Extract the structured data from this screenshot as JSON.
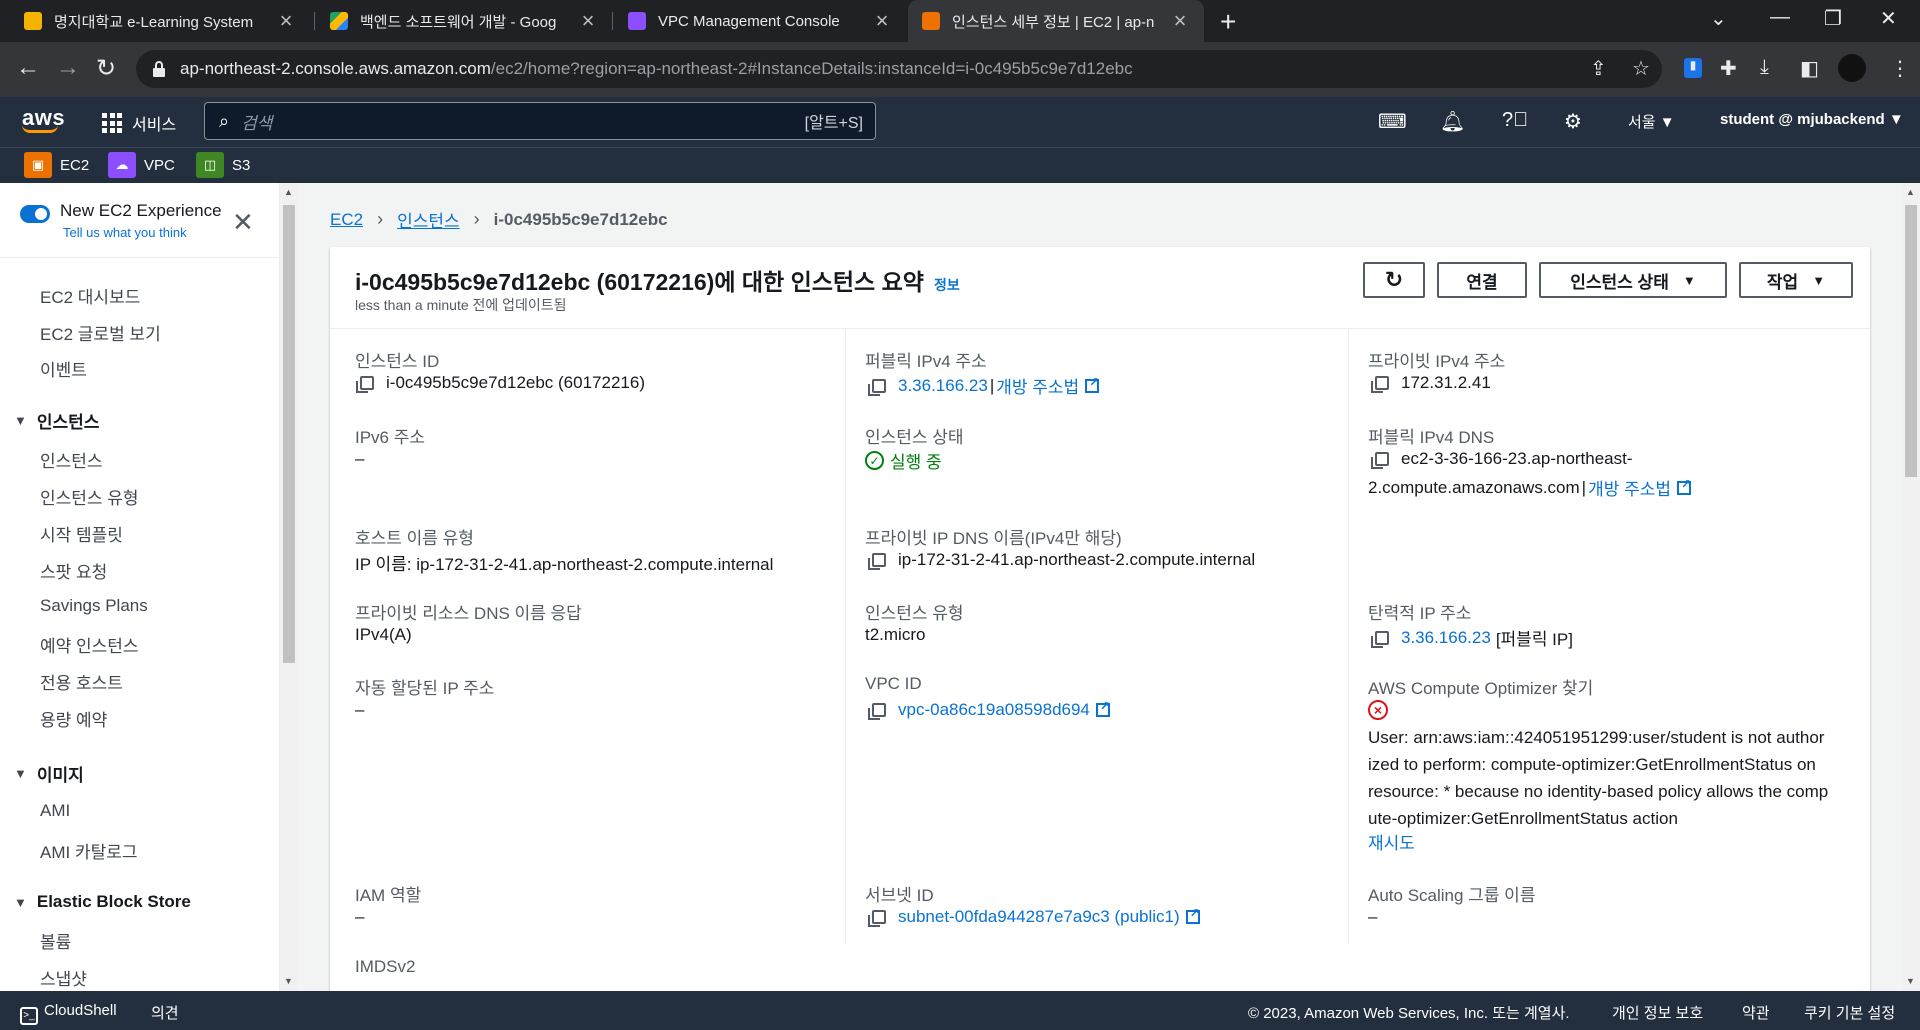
{
  "browser": {
    "tabs": [
      {
        "title": "명지대학교 e-Learning System",
        "active": false,
        "favicon_color": "#f5b300"
      },
      {
        "title": "백엔드 소프트웨어 개발 - Goog",
        "active": false,
        "favicon_color": "#1ea362"
      },
      {
        "title": "VPC Management Console",
        "active": false,
        "favicon_color": "#8c4fff"
      },
      {
        "title": "인스턴스 세부 정보 | EC2 | ap-n",
        "active": true,
        "favicon_color": "#ed7100"
      }
    ],
    "url_host": "ap-northeast-2.console.aws.amazon.com",
    "url_path": "/ec2/home?region=ap-northeast-2#InstanceDetails:instanceId=i-0c495b5c9e7d12ebc"
  },
  "aws_header": {
    "logo": "aws",
    "services_label": "서비스",
    "search_placeholder": "검색",
    "search_shortcut": "[알트+S]",
    "region": "서울 ▼",
    "user": "student @ mjubackend ▼"
  },
  "favorites": [
    {
      "label": "EC2",
      "color": "#ed7100"
    },
    {
      "label": "VPC",
      "color": "#8c4fff"
    },
    {
      "label": "S3",
      "color": "#3f8624"
    }
  ],
  "sidebar": {
    "new_exp_title": "New EC2 Experience",
    "new_exp_sub": "Tell us what you think",
    "items": {
      "dashboard": "EC2 대시보드",
      "global": "EC2 글로벌 보기",
      "events": "이벤트",
      "instances_head": "인스턴스",
      "instances": "인스턴스",
      "instance_types": "인스턴스 유형",
      "launch_templates": "시작 템플릿",
      "spot": "스팟 요청",
      "savings": "Savings Plans",
      "reserved": "예약 인스턴스",
      "dedicated": "전용 호스트",
      "capacity": "용량 예약",
      "images_head": "이미지",
      "ami": "AMI",
      "ami_catalog": "AMI 카탈로그",
      "ebs_head": "Elastic Block Store",
      "volumes": "볼륨",
      "snapshots": "스냅샷"
    }
  },
  "breadcrumb": {
    "root": "EC2",
    "mid": "인스턴스",
    "current": "i-0c495b5c9e7d12ebc"
  },
  "summary": {
    "title": "i-0c495b5c9e7d12ebc (60172216)에 대한 인스턴스 요약",
    "info": "정보",
    "updated": "less than a minute 전에 업데이트됨",
    "buttons": {
      "connect": "연결",
      "state": "인스턴스 상태",
      "actions": "작업"
    },
    "fields": {
      "instance_id_label": "인스턴스 ID",
      "instance_id": "i-0c495b5c9e7d12ebc (60172216)",
      "public_ipv4_label": "퍼블릭 IPv4 주소",
      "public_ipv4": "3.36.166.23",
      "open_address": "개방 주소법",
      "private_ipv4_label": "프라이빗 IPv4 주소",
      "private_ipv4": "172.31.2.41",
      "ipv6_label": "IPv6 주소",
      "ipv6": "–",
      "state_label": "인스턴스 상태",
      "state": "실행 중",
      "public_dns_label": "퍼블릭 IPv4 DNS",
      "public_dns_line1": "ec2-3-36-166-23.ap-northeast-",
      "public_dns_line2": "2.compute.amazonaws.com",
      "hostname_type_label": "호스트 이름 유형",
      "hostname_type": "IP 이름: ip-172-31-2-41.ap-northeast-2.compute.internal",
      "private_dns_label": "프라이빗 IP DNS 이름(IPv4만 해당)",
      "private_dns": "ip-172-31-2-41.ap-northeast-2.compute.internal",
      "resource_dns_label": "프라이빗 리소스 DNS 이름 응답",
      "resource_dns": "IPv4(A)",
      "instance_type_label": "인스턴스 유형",
      "instance_type": "t2.micro",
      "elastic_ip_label": "탄력적 IP 주소",
      "elastic_ip": "3.36.166.23",
      "elastic_ip_suffix": "[퍼블릭 IP]",
      "auto_ip_label": "자동 할당된 IP 주소",
      "auto_ip": "–",
      "vpc_label": "VPC ID",
      "vpc": "vpc-0a86c19a08598d694",
      "optimizer_label": "AWS Compute Optimizer 찾기",
      "optimizer_l1": "User: arn:aws:iam::424051951299:user/student is not author",
      "optimizer_l2": "ized to perform: compute-optimizer:GetEnrollmentStatus on",
      "optimizer_l3": "resource: * because no identity-based policy allows the comp",
      "optimizer_l4": "ute-optimizer:GetEnrollmentStatus action",
      "retry": "재시도",
      "iam_label": "IAM 역할",
      "iam": "–",
      "subnet_label": "서브넷 ID",
      "subnet": "subnet-00fda944287e7a9c3 (public1)",
      "asg_label": "Auto Scaling 그룹 이름",
      "asg": "–",
      "imds_label": "IMDSv2"
    }
  },
  "footer": {
    "cloudshell": "CloudShell",
    "feedback": "의견",
    "copyright": "© 2023, Amazon Web Services, Inc. 또는 계열사.",
    "privacy": "개인 정보 보호",
    "terms": "약관",
    "cookies": "쿠키 기본 설정"
  }
}
